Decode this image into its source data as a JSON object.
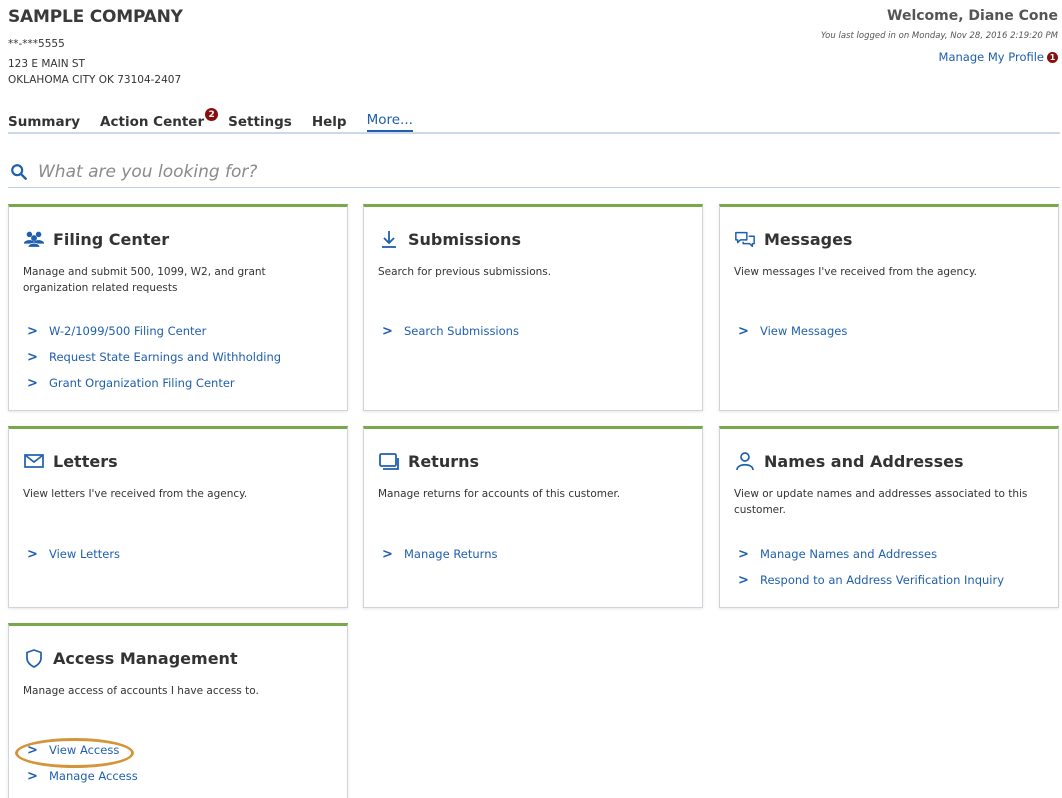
{
  "header": {
    "company": "SAMPLE COMPANY",
    "id": "**-***5555",
    "address1": "123 E MAIN ST",
    "address2": "OKLAHOMA CITY OK 73104-2407",
    "welcome": "Welcome, Diane Cone",
    "last_login": "You last logged in on Monday, Nov 28, 2016 2:19:20 PM",
    "profile_link": "Manage My Profile",
    "profile_badge": "1"
  },
  "nav": {
    "summary": "Summary",
    "action_center": "Action Center",
    "action_center_badge": "2",
    "settings": "Settings",
    "help": "Help",
    "more": "More..."
  },
  "search": {
    "placeholder": "What are you looking for?"
  },
  "cards": {
    "filing": {
      "title": "Filing Center",
      "icon": "people-group-icon",
      "desc": "Manage and submit 500, 1099, W2, and grant organization related requests",
      "links": [
        "W-2/1099/500 Filing Center",
        "Request State Earnings and Withholding",
        "Grant Organization Filing Center"
      ]
    },
    "submissions": {
      "title": "Submissions",
      "icon": "download-arrow-icon",
      "desc": "Search for previous submissions.",
      "links": [
        "Search Submissions"
      ]
    },
    "messages": {
      "title": "Messages",
      "icon": "chat-bubbles-icon",
      "desc": "View messages I've received from the agency.",
      "links": [
        "View Messages"
      ]
    },
    "letters": {
      "title": "Letters",
      "icon": "envelope-icon",
      "desc": "View letters I've received from the agency.",
      "links": [
        "View Letters"
      ]
    },
    "returns": {
      "title": "Returns",
      "icon": "stacked-returns-icon",
      "desc": "Manage returns for accounts of this customer.",
      "links": [
        "Manage Returns"
      ]
    },
    "names": {
      "title": "Names and Addresses",
      "icon": "person-icon",
      "desc": "View or update names and addresses associated to this customer.",
      "links": [
        "Manage Names and Addresses",
        "Respond to an Address Verification Inquiry"
      ]
    },
    "access": {
      "title": "Access Management",
      "icon": "shield-icon",
      "desc": "Manage access of accounts I have access to.",
      "links": [
        "View Access",
        "Manage Access"
      ]
    }
  },
  "colors": {
    "link": "#1f5fad",
    "card_accent": "#78a84b",
    "badge": "#8b0e0e",
    "highlight": "#d4943a"
  }
}
